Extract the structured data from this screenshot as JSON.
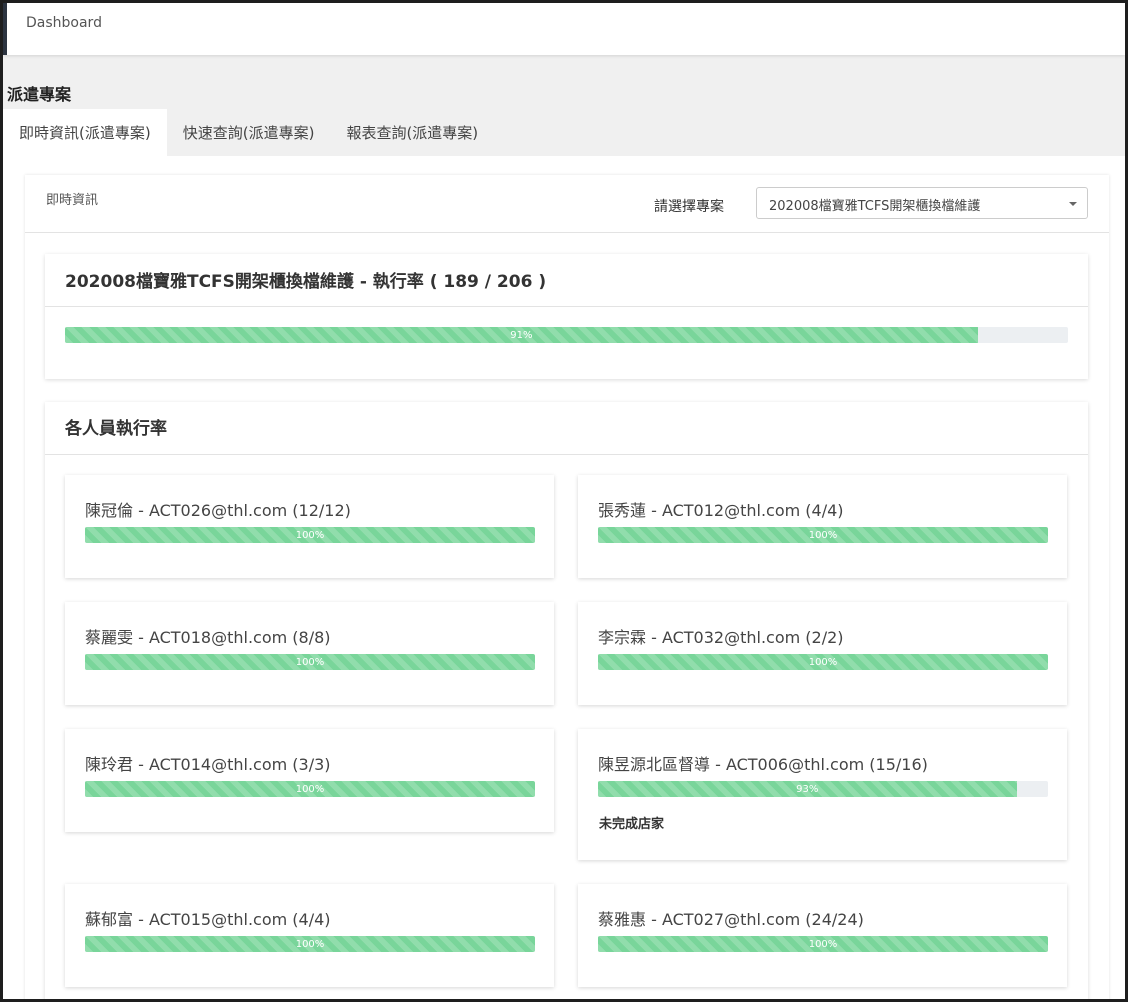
{
  "header": {
    "breadcrumb": "Dashboard"
  },
  "page": {
    "title": "派遣專案"
  },
  "tabs": [
    {
      "label": "即時資訊(派遣專案)"
    },
    {
      "label": "快速查詢(派遣專案)"
    },
    {
      "label": "報表查詢(派遣專案)"
    }
  ],
  "panel": {
    "label": "即時資訊",
    "select_label": "請選擇專案",
    "select_value": "202008檔寶雅TCFS開架櫃換檔維護"
  },
  "summary": {
    "title": "202008檔寶雅TCFS開架櫃換檔維護 - 執行率 ( 189 / 206 )",
    "progress": 0.91,
    "progress_label": "91%"
  },
  "staff_section": {
    "title": "各人員執行率"
  },
  "staff": [
    {
      "name": "陳冠倫 - ACT026@thl.com (12/12)",
      "progress": 1.0,
      "label": "100%"
    },
    {
      "name": "張秀蓮 - ACT012@thl.com (4/4)",
      "progress": 1.0,
      "label": "100%"
    },
    {
      "name": "蔡麗雯 - ACT018@thl.com (8/8)",
      "progress": 1.0,
      "label": "100%"
    },
    {
      "name": "李宗霖 - ACT032@thl.com (2/2)",
      "progress": 1.0,
      "label": "100%"
    },
    {
      "name": "陳玲君 - ACT014@thl.com (3/3)",
      "progress": 1.0,
      "label": "100%"
    },
    {
      "name": "陳昱源北區督導 - ACT006@thl.com (15/16)",
      "progress": 0.93,
      "label": "93%",
      "note": "未完成店家"
    },
    {
      "name": "蘇郁富 - ACT015@thl.com (4/4)",
      "progress": 1.0,
      "label": "100%"
    },
    {
      "name": "蔡雅惠 - ACT027@thl.com (24/24)",
      "progress": 1.0,
      "label": "100%"
    }
  ],
  "colors": {
    "progress_fill": "#79d59a",
    "progress_track": "#eceff2"
  }
}
